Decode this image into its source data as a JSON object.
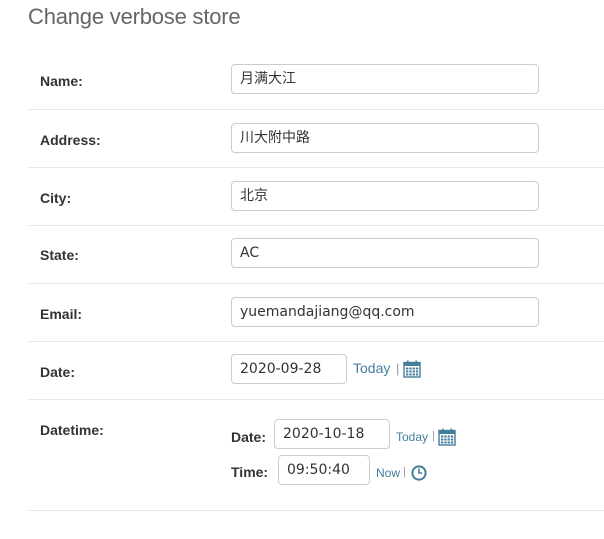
{
  "page": {
    "title": "Change verbose store"
  },
  "fields": {
    "name": {
      "label": "Name:",
      "value": "月满大江"
    },
    "address": {
      "label": "Address:",
      "value": "川大附中路"
    },
    "city": {
      "label": "City:",
      "value": "北京"
    },
    "state": {
      "label": "State:",
      "value": "AC"
    },
    "email": {
      "label": "Email:",
      "value": "yuemandajiang@qq.com"
    },
    "date": {
      "label": "Date:",
      "value": "2020-09-28",
      "today_label": "Today",
      "separator": "|"
    },
    "datetime": {
      "label": "Datetime:",
      "date_label": "Date:",
      "date_value": "2020-10-18",
      "today_label": "Today",
      "time_label": "Time:",
      "time_value": "09:50:40",
      "now_label": "Now",
      "separator": "|"
    }
  },
  "colors": {
    "link": "#447e9b",
    "title": "#666666",
    "border": "#cccccc"
  },
  "icons": {
    "calendar": "calendar-icon",
    "clock": "clock-icon"
  }
}
